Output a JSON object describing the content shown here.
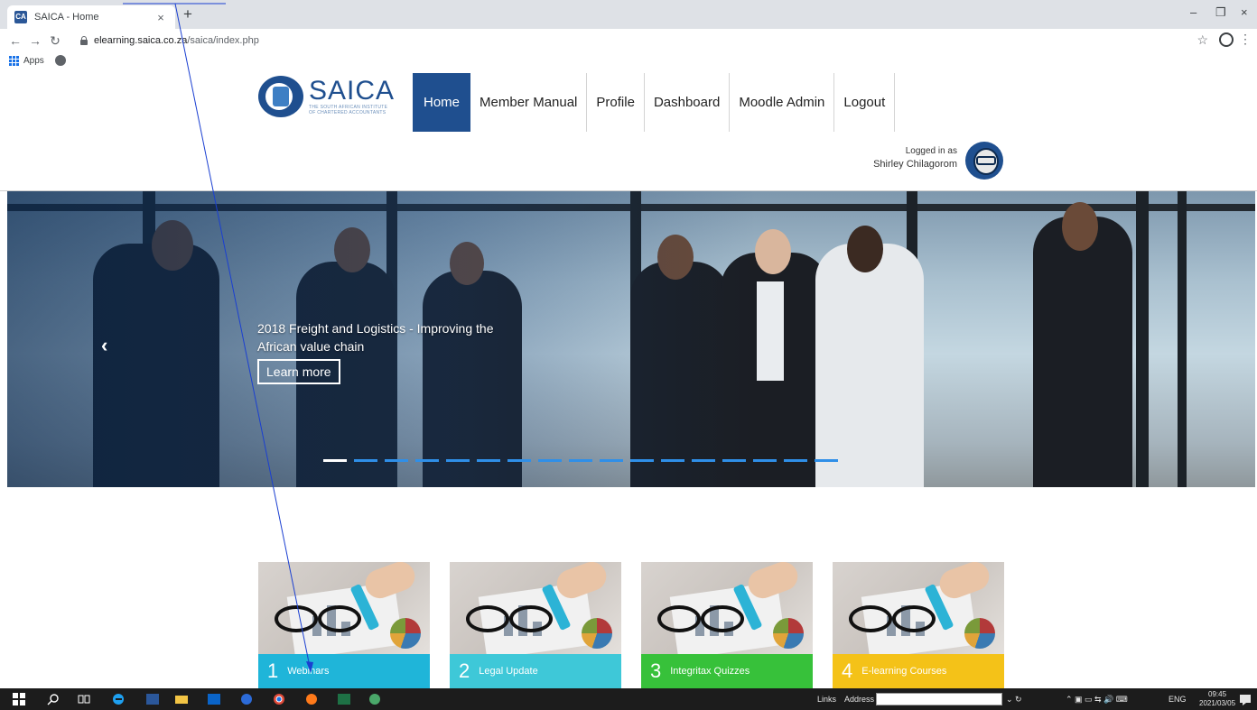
{
  "browser": {
    "tab_title": "SAICA - Home",
    "tab_close": "×",
    "new_tab": "+",
    "window_min": "–",
    "window_max": "❐",
    "window_close": "×",
    "url_host": "elearning.saica.co.za",
    "url_path": "/saica/index.php",
    "bookmark_apps": "Apps"
  },
  "site": {
    "logo_name": "SAICA",
    "logo_sub_line1": "THE SOUTH AFRICAN INSTITUTE",
    "logo_sub_line2": "OF CHARTERED ACCOUNTANTS",
    "nav": [
      "Home",
      "Member Manual",
      "Profile",
      "Dashboard",
      "Moodle Admin",
      "Logout"
    ],
    "active_nav": "Home",
    "user_label": "Logged in as",
    "user_name": "Shirley Chilagorom"
  },
  "hero": {
    "arrow_prev": "‹",
    "caption_line1": "2018 Freight and Logistics - Improving the",
    "caption_line2": "African value chain",
    "button_label": "Learn more",
    "slide_count": 17,
    "active_slide": 1
  },
  "tiles": [
    {
      "number": "1",
      "label": "Webinars",
      "color": "#1fb5d9"
    },
    {
      "number": "2",
      "label": "Legal Update",
      "color": "#3ec8d8"
    },
    {
      "number": "3",
      "label": "Integritax Quizzes",
      "color": "#37c13a"
    },
    {
      "number": "4",
      "label": "E-learning Courses",
      "color": "#f4c218"
    }
  ],
  "taskbar": {
    "links_label": "Links",
    "address_label": "Address",
    "language": "ENG",
    "time": "09:45",
    "date": "2021/03/05"
  },
  "colors": {
    "brand_blue": "#1f4f8f",
    "slider_dot": "#2f8fe8",
    "annotation_line": "#1a3fd1"
  }
}
